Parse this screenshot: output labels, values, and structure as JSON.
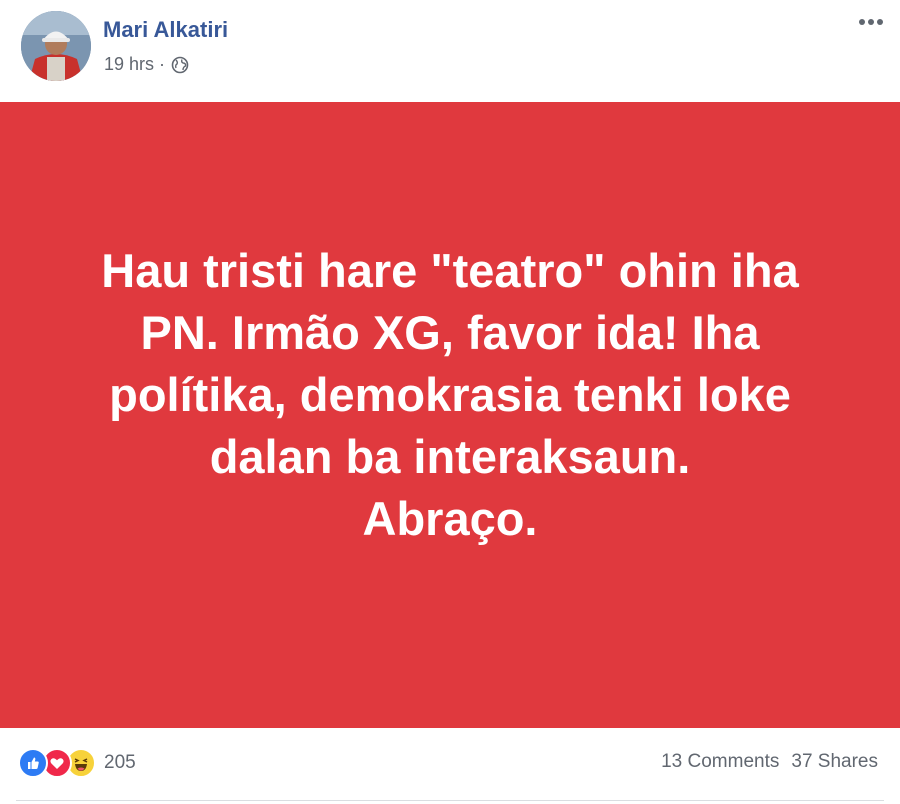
{
  "post": {
    "author_name": "Mari Alkatiri",
    "timestamp": "19 hrs",
    "separator": "·",
    "privacy_icon": "globe-icon",
    "menu_icon": "more-horizontal-icon",
    "text": "Hau tristi hare \"teatro\" ohin iha\nPN. Irmão XG, favor ida! Iha\npolítika, demokrasia tenki loke\ndalan ba interaksaun.\nAbraço.",
    "background_color": "#e0393e"
  },
  "footer": {
    "reaction_icons": [
      "like-icon",
      "love-icon",
      "haha-icon"
    ],
    "reaction_count": "205",
    "comments": "13 Comments",
    "shares": "37 Shares"
  },
  "colors": {
    "author_link": "#385898",
    "meta_text": "#616770",
    "like": "#2d7bf4",
    "love": "#f0284a",
    "haha": "#f7d23a"
  }
}
